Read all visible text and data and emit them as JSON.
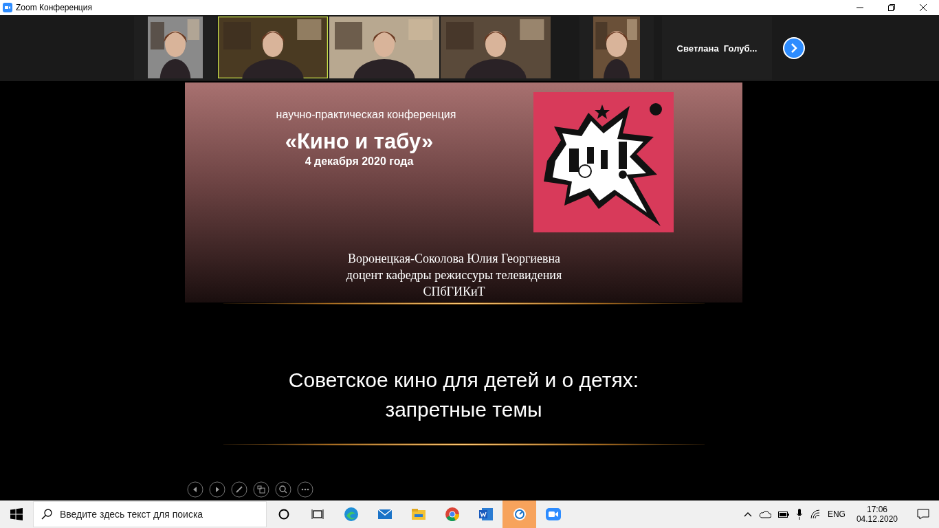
{
  "window": {
    "title": "Zoom Конференция"
  },
  "participants": [
    {
      "kind": "video",
      "speaking": false
    },
    {
      "kind": "video",
      "speaking": true
    },
    {
      "kind": "video",
      "speaking": false
    },
    {
      "kind": "video",
      "speaking": false
    },
    {
      "kind": "video",
      "speaking": false
    },
    {
      "kind": "name",
      "name": "Светлана  Голуб..."
    }
  ],
  "slide": {
    "subtitle": "научно-практическая конференция",
    "title": "«Кино и табу»",
    "date": "4 декабря 2020 года",
    "image": {
      "kind": "picture"
    },
    "speaker": [
      "Воронецкая-Соколова Юлия Георгиевна",
      "доцент кафедры режиссуры телевидения",
      "СПбГИКиТ"
    ],
    "topic": [
      "Советское кино для детей и о детях:",
      "запретные темы"
    ]
  },
  "taskbar": {
    "search": {
      "placeholder": "Введите здесь текст для поиска"
    },
    "apps": [
      {
        "kind": "edge",
        "selected": false
      },
      {
        "kind": "mail",
        "selected": false
      },
      {
        "kind": "explorer",
        "selected": false
      },
      {
        "kind": "chrome",
        "selected": false
      },
      {
        "kind": "word",
        "selected": false
      },
      {
        "kind": "app",
        "selected": true
      },
      {
        "kind": "zoom",
        "selected": false
      }
    ],
    "language": "ENG",
    "time": "17:06",
    "date": "04.12.2020"
  }
}
